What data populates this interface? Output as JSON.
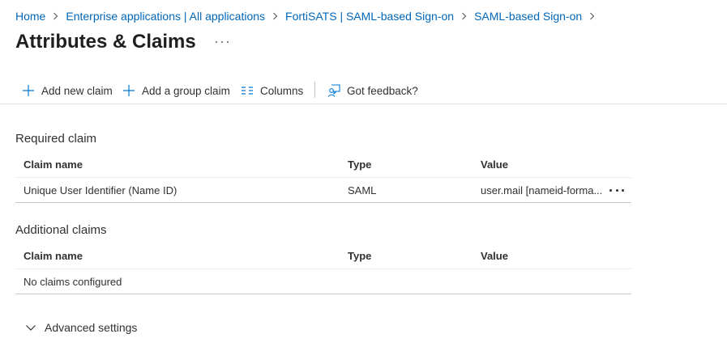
{
  "breadcrumb": {
    "items": [
      "Home",
      "Enterprise applications | All applications",
      "FortiSATS | SAML-based Sign-on",
      "SAML-based Sign-on"
    ]
  },
  "header": {
    "title": "Attributes & Claims"
  },
  "toolbar": {
    "add_new_claim": "Add new claim",
    "add_group_claim": "Add a group claim",
    "columns": "Columns",
    "feedback": "Got feedback?"
  },
  "required": {
    "title": "Required claim",
    "columns": [
      "Claim name",
      "Type",
      "Value"
    ],
    "rows": [
      {
        "name": "Unique User Identifier (Name ID)",
        "type": "SAML",
        "value": "user.mail [nameid-forma..."
      }
    ]
  },
  "additional": {
    "title": "Additional claims",
    "columns": [
      "Claim name",
      "Type",
      "Value"
    ],
    "empty": "No claims configured"
  },
  "advanced": {
    "label": "Advanced settings"
  },
  "colors": {
    "link": "#0066b8",
    "accent": "#0078d4",
    "text": "#323130",
    "border": "#e1dfdd"
  },
  "icons": [
    "chevron-right-icon",
    "more-icon",
    "add-icon",
    "columns-icon",
    "feedback-icon",
    "chevron-down-icon"
  ]
}
